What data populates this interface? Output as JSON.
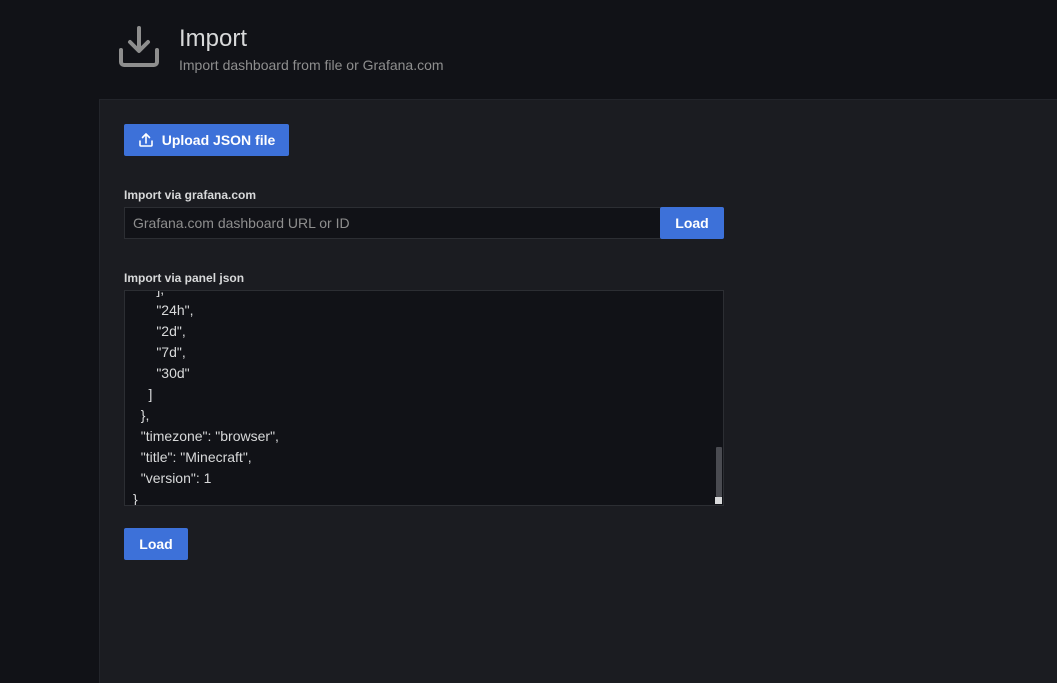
{
  "header": {
    "icon": "download-icon",
    "title": "Import",
    "subtitle": "Import dashboard from file or Grafana.com"
  },
  "upload": {
    "icon": "upload-icon",
    "label": "Upload JSON file"
  },
  "gcom": {
    "label": "Import via grafana.com",
    "placeholder": "Grafana.com dashboard URL or ID",
    "value": "",
    "button_label": "Load"
  },
  "panel_json": {
    "label": "Import via panel json",
    "content": "      ],\n      \"24h\",\n      \"2d\",\n      \"7d\",\n      \"30d\"\n    ]\n  },\n  \"timezone\": \"browser\",\n  \"title\": \"Minecraft\",\n  \"version\": 1\n}",
    "button_label": "Load"
  },
  "colors": {
    "accent": "#3d71d9",
    "background": "#111217",
    "panel": "#1b1c21"
  }
}
